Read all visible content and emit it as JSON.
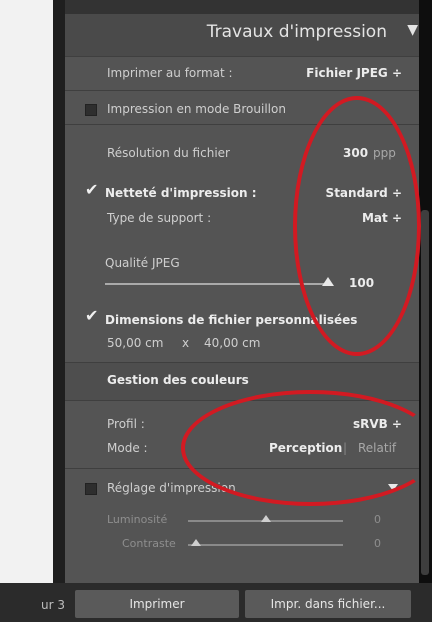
{
  "left": {
    "pager_text": "ur 3"
  },
  "panel": {
    "title": "Travaux d'impression",
    "collapse_icon": "triangle-down-icon",
    "format": {
      "label": "Imprimer au format :",
      "value": "Fichier JPEG ÷"
    },
    "draft": {
      "label": "Impression en mode Brouillon",
      "checked": false
    },
    "resolution": {
      "label": "Résolution du fichier",
      "value": "300",
      "unit": "ppp"
    },
    "sharpen": {
      "label": "Netteté d'impression :",
      "value": "Standard ÷",
      "checked": true
    },
    "media": {
      "label": "Type de support :",
      "value": "Mat ÷"
    },
    "jpeg_quality": {
      "label": "Qualité JPEG",
      "value": "100",
      "level": 100
    },
    "custom_dims": {
      "label": "Dimensions de fichier personnalisées",
      "checked": true,
      "width": "50,00 cm",
      "sep": "x",
      "height": "40,00 cm"
    },
    "color": {
      "heading": "Gestion des couleurs",
      "profile_label": "Profil :",
      "profile_value": "sRVB ÷",
      "mode_label": "Mode :",
      "mode_perceptual": "Perception",
      "mode_sep": "|",
      "mode_relative": "Relatif"
    },
    "adjust": {
      "label": "Réglage d'impression",
      "checked": false,
      "brightness_label": "Luminosité",
      "brightness_value": "0",
      "contrast_label": "Contraste",
      "contrast_value": "0"
    }
  },
  "buttons": {
    "print": "Imprimer",
    "print_to_file": "Impr. dans fichier..."
  },
  "colors": {
    "annotation": "#d21a22",
    "panel": "#515151"
  }
}
